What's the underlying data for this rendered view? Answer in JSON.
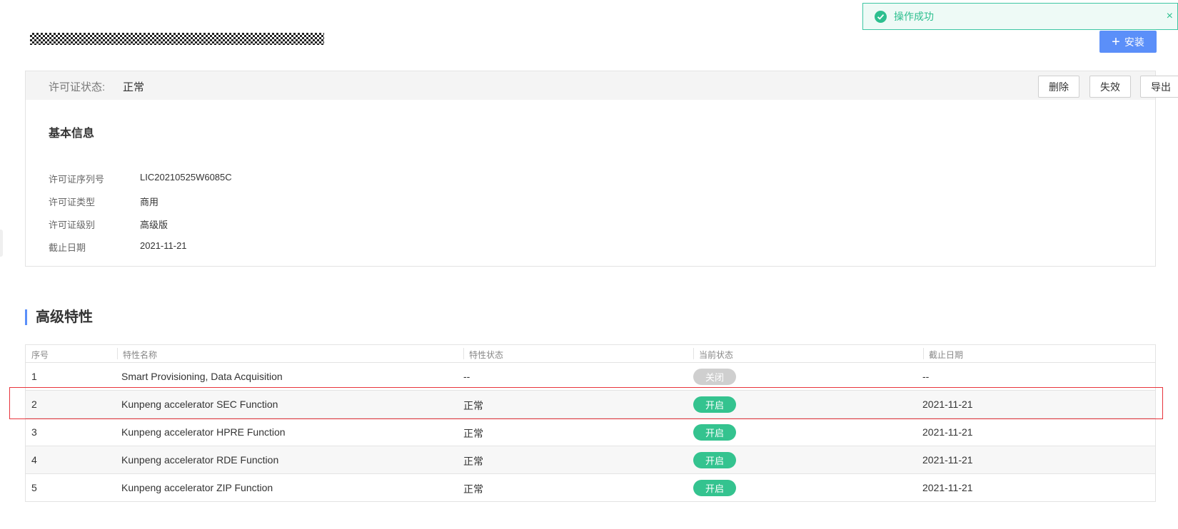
{
  "toast": {
    "message": "操作成功",
    "close_glyph": "×",
    "icon": "check-circle-icon",
    "color": "#2dbf8f"
  },
  "toolbar": {
    "install_label": "安装",
    "plus_glyph": "+"
  },
  "license": {
    "status_label": "许可证状态:",
    "status_value": "正常",
    "buttons": {
      "delete": "删除",
      "invalidate": "失效",
      "export": "导出"
    },
    "section_title": "基本信息",
    "fields": [
      {
        "label": "许可证序列号",
        "value": "LIC20210525W6085C"
      },
      {
        "label": "许可证类型",
        "value": "商用"
      },
      {
        "label": "许可证级别",
        "value": "高级版"
      },
      {
        "label": "截止日期",
        "value": "2021-11-21"
      }
    ]
  },
  "features": {
    "title": "高级特性",
    "columns": [
      "序号",
      "特性名称",
      "特性状态",
      "当前状态",
      "截止日期"
    ],
    "rows": [
      {
        "index": "1",
        "name": "Smart Provisioning, Data Acquisition",
        "feature_status": "--",
        "current_state": "关闭",
        "expiry": "--"
      },
      {
        "index": "2",
        "name": "Kunpeng accelerator SEC Function",
        "feature_status": "正常",
        "current_state": "开启",
        "expiry": "2021-11-21"
      },
      {
        "index": "3",
        "name": "Kunpeng accelerator HPRE Function",
        "feature_status": "正常",
        "current_state": "开启",
        "expiry": "2021-11-21"
      },
      {
        "index": "4",
        "name": "Kunpeng accelerator RDE Function",
        "feature_status": "正常",
        "current_state": "开启",
        "expiry": "2021-11-21"
      },
      {
        "index": "5",
        "name": "Kunpeng accelerator ZIP Function",
        "feature_status": "正常",
        "current_state": "开启",
        "expiry": "2021-11-21"
      }
    ]
  },
  "colors": {
    "accent": "#5b8ff9",
    "on": "#34c38f",
    "off": "#cfcfcf",
    "highlight": "#e8343c"
  }
}
